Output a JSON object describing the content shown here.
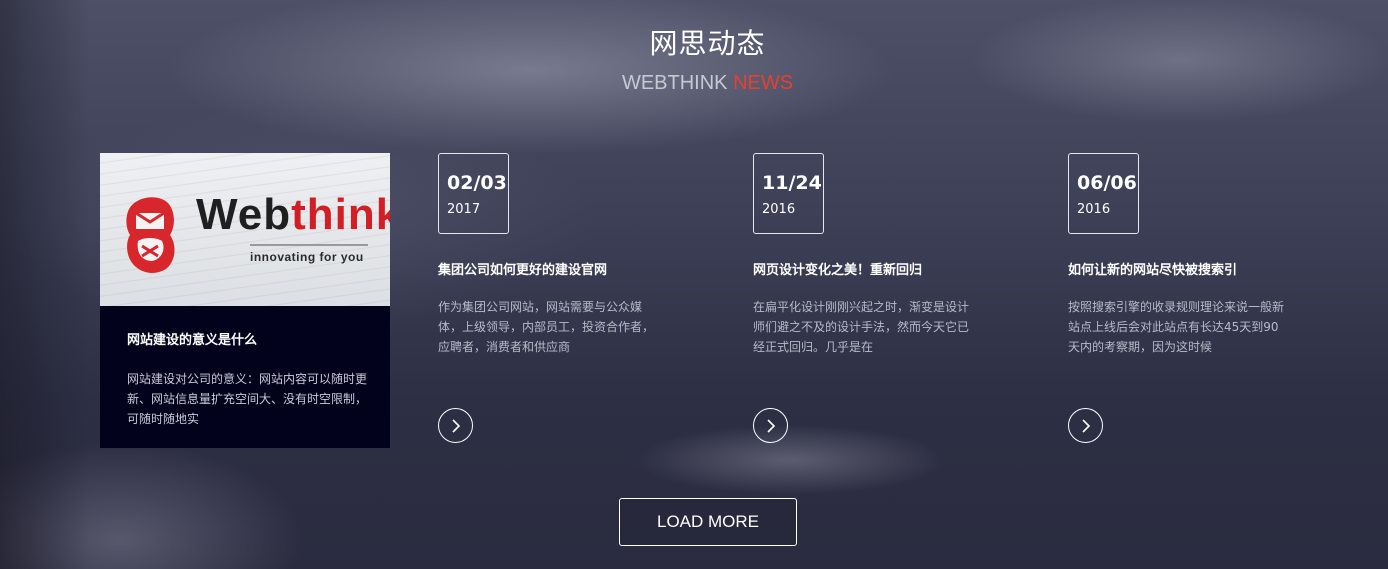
{
  "section": {
    "title": "网思动态",
    "subtitle_part1": "WEBTHINK",
    "subtitle_part2": "NEWS",
    "accent_color": "#e8402f"
  },
  "featured": {
    "image_logo_text_1": "Web",
    "image_logo_text_2": "think",
    "image_tagline": "innovating for you",
    "title": "网站建设的意义是什么",
    "excerpt": "网站建设对公司的意义：网站内容可以随时更新、网站信息量扩充空间大、没有时空限制，可随时随地实",
    "card_color": "#03021d"
  },
  "news": [
    {
      "date_md": "02/03",
      "year": "2017",
      "title": "集团公司如何更好的建设官网",
      "excerpt": "作为集团公司网站，网站需要与公众媒体，上级领导，内部员工，投资合作者，应聘者，消费者和供应商",
      "more_icon": "chevron-right-icon"
    },
    {
      "date_md": "11/24",
      "year": "2016",
      "title": "网页设计变化之美！重新回归",
      "excerpt": "在扁平化设计刚刚兴起之时，渐变是设计师们避之不及的设计手法，然而今天它已经正式回归。几乎是在",
      "more_icon": "chevron-right-icon"
    },
    {
      "date_md": "06/06",
      "year": "2016",
      "title": "如何让新的网站尽快被搜索引",
      "excerpt": "按照搜索引擎的收录规则理论来说一般新站点上线后会对此站点有长达45天到90天内的考察期，因为这时候",
      "more_icon": "chevron-right-icon"
    }
  ],
  "load_more_label": "LOAD MORE"
}
